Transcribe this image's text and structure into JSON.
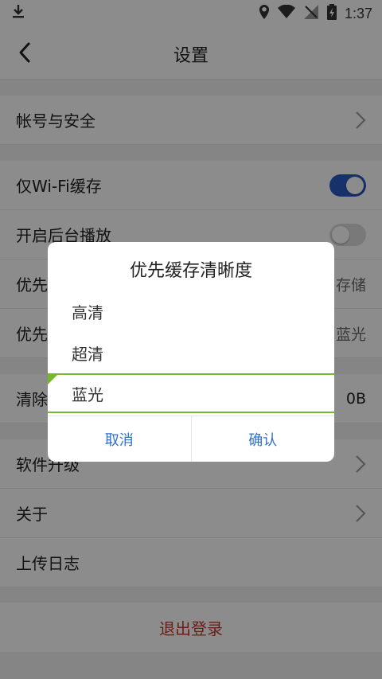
{
  "status": {
    "time": "1:37",
    "icons": [
      "download-icon",
      "location-icon",
      "wifi-icon",
      "signal-icon",
      "battery-charging-icon"
    ]
  },
  "header": {
    "title": "设置"
  },
  "settings": {
    "account": "帐号与安全",
    "wifi_cache": "仅Wi-Fi缓存",
    "background_play": "开启后台播放",
    "cache_location_label": "优先缓存路径",
    "cache_location_value": "存储",
    "cache_quality_label": "优先缓存清晰度",
    "cache_quality_value": "蓝光",
    "clear_cache_label": "清除缓存",
    "clear_cache_value": "0B",
    "upgrade": "软件升级",
    "about": "关于",
    "upload_log": "上传日志",
    "logout": "退出登录"
  },
  "dialog": {
    "title": "优先缓存清晰度",
    "options": [
      "高清",
      "超清",
      "蓝光"
    ],
    "selected_index": 2,
    "cancel": "取消",
    "confirm": "确认"
  },
  "colors": {
    "accent": "#2b59c3",
    "selected": "#76b82a",
    "logout": "#c0392b",
    "dialog_button": "#2f6fcf"
  }
}
